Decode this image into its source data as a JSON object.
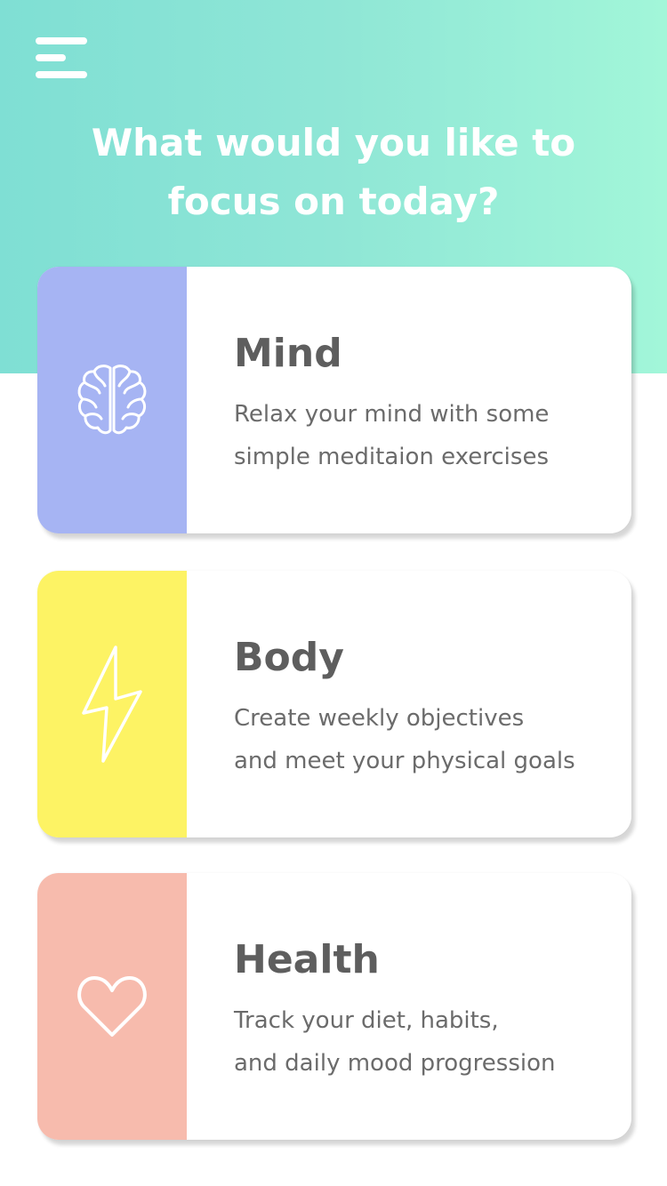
{
  "header": {
    "title": "What would you like to focus on today?",
    "menu_icon": "hamburger-menu-icon",
    "background_colors": [
      "#7fdfd4",
      "#a2f6d9"
    ]
  },
  "cards": [
    {
      "title": "Mind",
      "description_lines": [
        "Relax your mind with some",
        "simple meditaion exercises"
      ],
      "icon": "brain-icon",
      "color": "#a6b4f3"
    },
    {
      "title": "Body",
      "description_lines": [
        "Create weekly objectives",
        "and meet your physical goals"
      ],
      "icon": "lightning-bolt-icon",
      "color": "#fdf364"
    },
    {
      "title": "Health",
      "description_lines": [
        "Track your diet, habits,",
        "and daily mood progression"
      ],
      "icon": "heart-icon",
      "color": "#f7bbad"
    }
  ]
}
